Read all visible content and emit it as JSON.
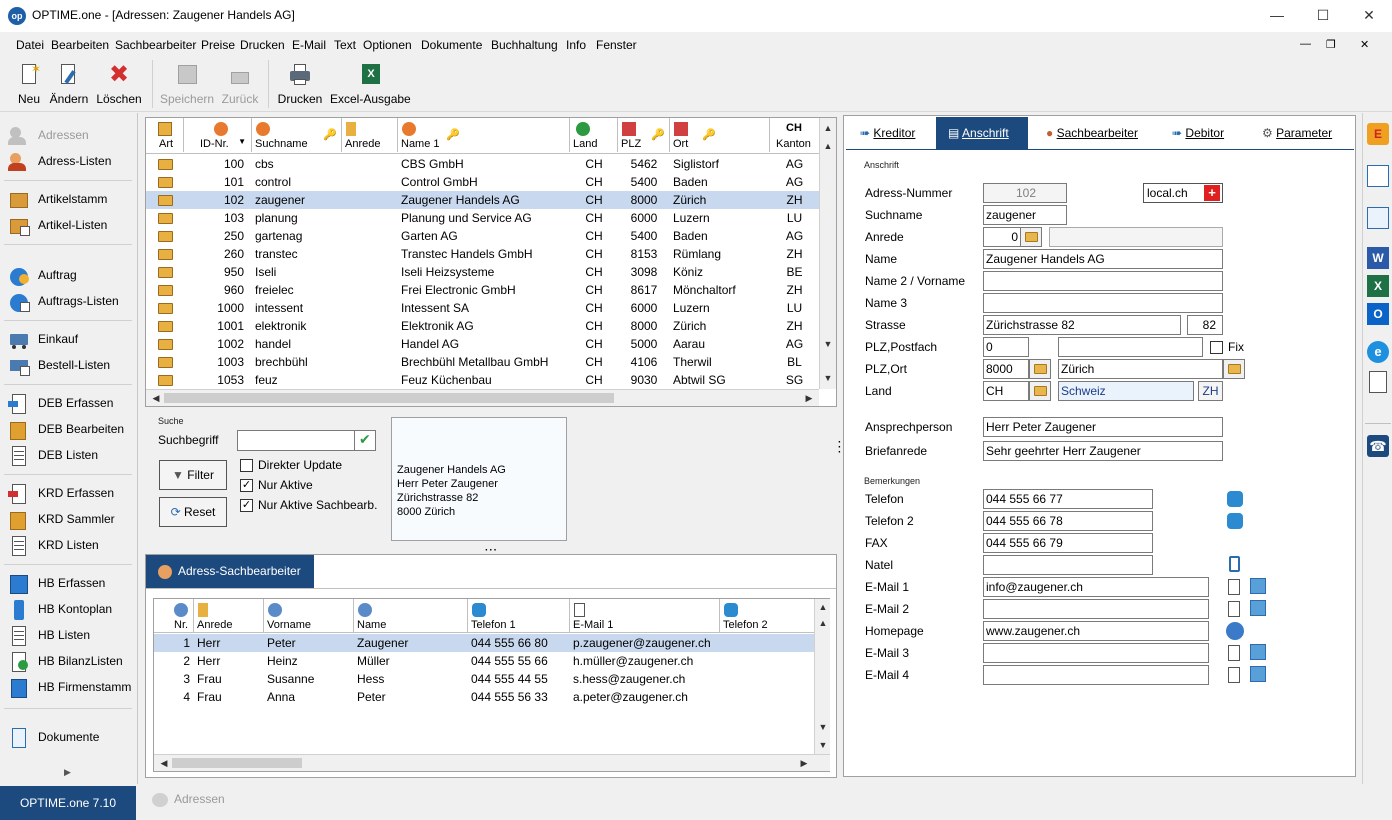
{
  "window": {
    "title": "OPTIME.one - [Adressen: Zaugener Handels AG]",
    "logo": "op"
  },
  "menu": [
    "Datei",
    "Bearbeiten",
    "Sachbearbeiter",
    "Preise",
    "Drucken",
    "E-Mail",
    "Text",
    "Optionen",
    "Dokumente",
    "Buchhaltung",
    "Info",
    "Fenster"
  ],
  "toolbar": {
    "neu": "Neu",
    "aendern": "Ändern",
    "loeschen": "Löschen",
    "speichern": "Speichern",
    "zurueck": "Zurück",
    "drucken": "Drucken",
    "excel": "Excel-Ausgabe"
  },
  "nav": {
    "adressen": "Adressen",
    "adress_listen": "Adress-Listen",
    "artikelstamm": "Artikelstamm",
    "artikel_listen": "Artikel-Listen",
    "auftrag": "Auftrag",
    "auftrags_listen": "Auftrags-Listen",
    "einkauf": "Einkauf",
    "bestell_listen": "Bestell-Listen",
    "deb_erfassen": "DEB Erfassen",
    "deb_bearbeiten": "DEB Bearbeiten",
    "deb_listen": "DEB Listen",
    "krd_erfassen": "KRD Erfassen",
    "krd_sammler": "KRD Sammler",
    "krd_listen": "KRD Listen",
    "hb_erfassen": "HB Erfassen",
    "hb_kontoplan": "HB Kontoplan",
    "hb_listen": "HB Listen",
    "hb_bilanzlisten": "HB BilanzListen",
    "hb_firmenstamm": "HB Firmenstamm",
    "dokumente": "Dokumente"
  },
  "footer": {
    "version": "OPTIME.one  7.10",
    "tab": "Adressen"
  },
  "grid": {
    "columns": {
      "art": "Art",
      "id": "ID-Nr.",
      "suchname": "Suchname",
      "anrede": "Anrede",
      "name1": "Name 1",
      "land": "Land",
      "plz": "PLZ",
      "ort": "Ort",
      "kanton": "Kanton",
      "kanton_top": "CH"
    },
    "rows": [
      {
        "id": "100",
        "suchname": "cbs",
        "name1": "CBS GmbH",
        "land": "CH",
        "plz": "5462",
        "ort": "Siglistorf",
        "kanton": "AG"
      },
      {
        "id": "101",
        "suchname": "control",
        "name1": "Control GmbH",
        "land": "CH",
        "plz": "5400",
        "ort": "Baden",
        "kanton": "AG"
      },
      {
        "id": "102",
        "suchname": "zaugener",
        "name1": "Zaugener Handels AG",
        "land": "CH",
        "plz": "8000",
        "ort": "Zürich",
        "kanton": "ZH"
      },
      {
        "id": "103",
        "suchname": "planung",
        "name1": "Planung und Service AG",
        "land": "CH",
        "plz": "6000",
        "ort": "Luzern",
        "kanton": "LU"
      },
      {
        "id": "250",
        "suchname": "gartenag",
        "name1": "Garten AG",
        "land": "CH",
        "plz": "5400",
        "ort": "Baden",
        "kanton": "AG"
      },
      {
        "id": "260",
        "suchname": "transtec",
        "name1": "Transtec Handels GmbH",
        "land": "CH",
        "plz": "8153",
        "ort": "Rümlang",
        "kanton": "ZH"
      },
      {
        "id": "950",
        "suchname": "Iseli",
        "name1": "Iseli Heizsysteme",
        "land": "CH",
        "plz": "3098",
        "ort": "Köniz",
        "kanton": "BE"
      },
      {
        "id": "960",
        "suchname": "freielec",
        "name1": "Frei Electronic GmbH",
        "land": "CH",
        "plz": "8617",
        "ort": "Mönchaltorf",
        "kanton": "ZH"
      },
      {
        "id": "1000",
        "suchname": "intessent",
        "name1": "Intessent SA",
        "land": "CH",
        "plz": "6000",
        "ort": "Luzern",
        "kanton": "LU"
      },
      {
        "id": "1001",
        "suchname": "elektronik",
        "name1": "Elektronik AG",
        "land": "CH",
        "plz": "8000",
        "ort": "Zürich",
        "kanton": "ZH"
      },
      {
        "id": "1002",
        "suchname": "handel",
        "name1": "Handel AG",
        "land": "CH",
        "plz": "5000",
        "ort": "Aarau",
        "kanton": "AG"
      },
      {
        "id": "1003",
        "suchname": "brechbühl",
        "name1": "Brechbühl Metallbau GmbH",
        "land": "CH",
        "plz": "4106",
        "ort": "Therwil",
        "kanton": "BL"
      },
      {
        "id": "1053",
        "suchname": "feuz",
        "name1": "Feuz Küchenbau",
        "land": "CH",
        "plz": "9030",
        "ort": "Abtwil SG",
        "kanton": "SG"
      }
    ]
  },
  "search": {
    "section": "Suche",
    "label": "Suchbegriff",
    "value": "",
    "filter": "Filter",
    "reset": "Reset",
    "direkter_update": "Direkter Update",
    "nur_aktive": "Nur Aktive",
    "nur_aktive_sb": "Nur Aktive Sachbearb."
  },
  "preview": {
    "lines": [
      "Zaugener Handels AG",
      "Herr Peter Zaugener",
      "Zürichstrasse 82",
      "8000 Zürich"
    ]
  },
  "sb": {
    "tab": "Adress-Sachbearbeiter",
    "columns": {
      "nr": "Nr.",
      "anrede": "Anrede",
      "vorname": "Vorname",
      "name": "Name",
      "tel1": "Telefon 1",
      "email1": "E-Mail 1",
      "tel2": "Telefon 2"
    },
    "rows": [
      {
        "nr": "1",
        "anrede": "Herr",
        "vorname": "Peter",
        "name": "Zaugener",
        "tel1": "044 555 66 80",
        "email1": "p.zaugener@zaugener.ch"
      },
      {
        "nr": "2",
        "anrede": "Herr",
        "vorname": "Heinz",
        "name": "Müller",
        "tel1": "044 555 55 66",
        "email1": "h.müller@zaugener.ch"
      },
      {
        "nr": "3",
        "anrede": "Frau",
        "vorname": "Susanne",
        "name": "Hess",
        "tel1": "044 555 44 55",
        "email1": "s.hess@zaugener.ch"
      },
      {
        "nr": "4",
        "anrede": "Frau",
        "vorname": "Anna",
        "name": "Peter",
        "tel1": "044 555 56 33",
        "email1": "a.peter@zaugener.ch"
      }
    ]
  },
  "detail": {
    "tabs": {
      "kreditor": "Kreditor",
      "anschrift": "Anschrift",
      "sachbearbeiter": "Sachbearbeiter",
      "debitor": "Debitor",
      "parameter": "Parameter"
    },
    "section_anschrift": "Anschrift",
    "section_bemerkungen": "Bemerkungen",
    "labels": {
      "adressnr": "Adress-Nummer",
      "suchname": "Suchname",
      "anrede": "Anrede",
      "name": "Name",
      "name2": "Name 2 / Vorname",
      "name3": "Name 3",
      "strasse": "Strasse",
      "plzpostfach": "PLZ,Postfach",
      "plzort": "PLZ,Ort",
      "land": "Land",
      "ansprechperson": "Ansprechperson",
      "briefanrede": "Briefanrede",
      "telefon": "Telefon",
      "telefon2": "Telefon 2",
      "fax": "FAX",
      "natel": "Natel",
      "email1": "E-Mail 1",
      "email2": "E-Mail 2",
      "homepage": "Homepage",
      "email3": "E-Mail 3",
      "email4": "E-Mail 4",
      "fix": "Fix"
    },
    "values": {
      "adressnr": "102",
      "suchname": "zaugener",
      "anrede_code": "0",
      "anrede_text": "",
      "name": "Zaugener Handels AG",
      "name2": "",
      "name3": "",
      "strasse": "Zürichstrasse 82",
      "hausnr": "82",
      "plz_postfach": "0",
      "postfach": "",
      "plz": "8000",
      "ort": "Zürich",
      "land_code": "CH",
      "land_name": "Schweiz",
      "kanton": "ZH",
      "ansprechperson": "Herr Peter Zaugener",
      "briefanrede": "Sehr geehrter Herr Zaugener",
      "telefon": "044 555 66 77",
      "telefon2": "044 555 66 78",
      "fax": "044 555 66 79",
      "natel": "",
      "email1": "info@zaugener.ch",
      "email2": "",
      "homepage": "www.zaugener.ch",
      "email3": "",
      "email4": ""
    },
    "localch": "local.ch"
  },
  "colors": {
    "accent": "#1d4a7e",
    "selection": "#c8d8ee"
  }
}
